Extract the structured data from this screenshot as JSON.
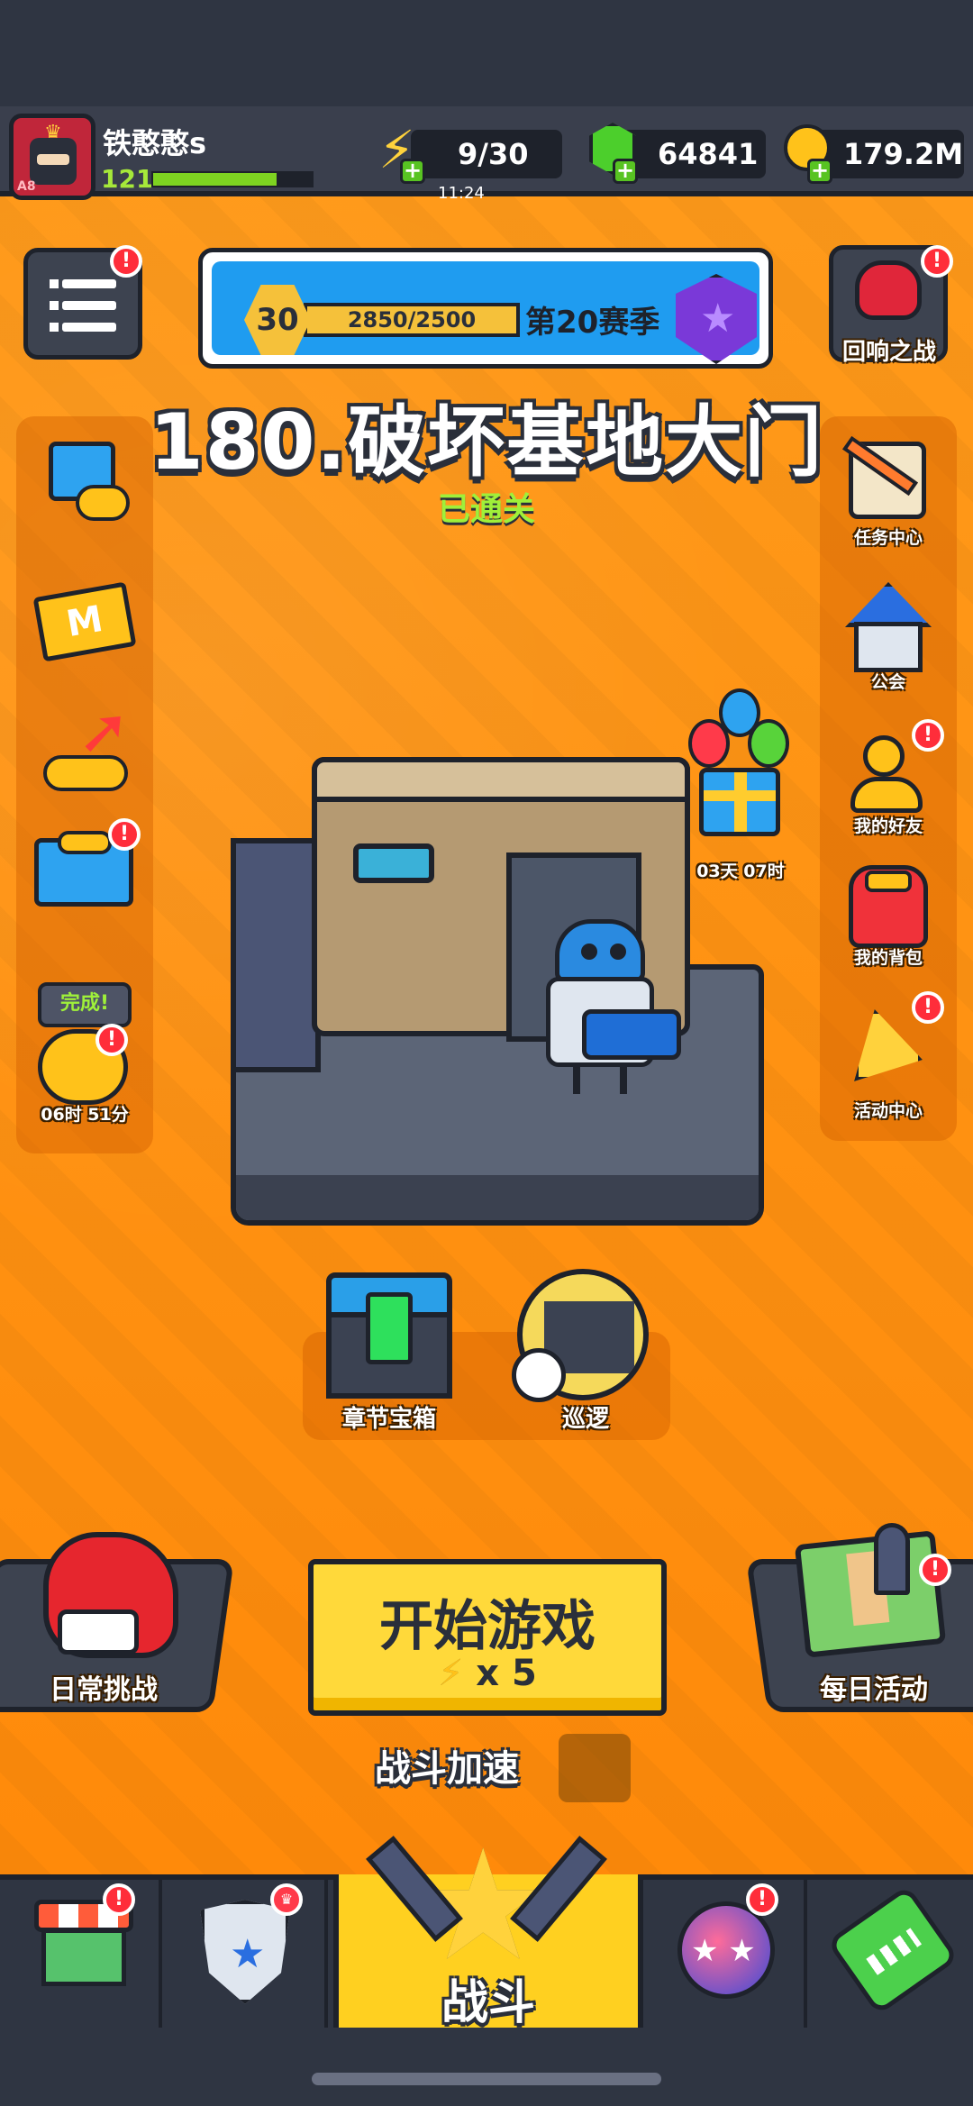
{
  "player": {
    "name": "铁憨憨s",
    "level": "121",
    "xp_fraction": 0.78,
    "avatar_tag": "A8"
  },
  "resources": {
    "energy": "9/30",
    "energy_timer": "11:24",
    "gems": "64841",
    "coins": "179.2M"
  },
  "season": {
    "level": "30",
    "progress": "2850/2500",
    "label": "第20赛季"
  },
  "stage": {
    "title": "180.破坏基地大门",
    "status": "已通关"
  },
  "right_panel": {
    "echo_battle": "回响之战",
    "task_center": "任务中心",
    "guild": "公会",
    "friends": "我的好友",
    "backpack": "我的背包",
    "event_center": "活动中心"
  },
  "left_panel": {
    "complete_tag": "完成!",
    "piggy_timer": "06时 51分"
  },
  "gift_timer": "03天 07时",
  "chest_label": "章节宝箱",
  "patrol_label": "巡逻",
  "daily_challenge": "日常挑战",
  "daily_activity": "每日活动",
  "start": {
    "title": "开始游戏",
    "cost": "x 5"
  },
  "battle_speed": "战斗加速",
  "tabs": {
    "battle": "战斗"
  },
  "badge_mark": "!",
  "colors": {
    "background": "#ff9414",
    "accent_yellow": "#ffd93a",
    "badge_red": "#ff2d3a",
    "cleared_green": "#9ff03a"
  }
}
